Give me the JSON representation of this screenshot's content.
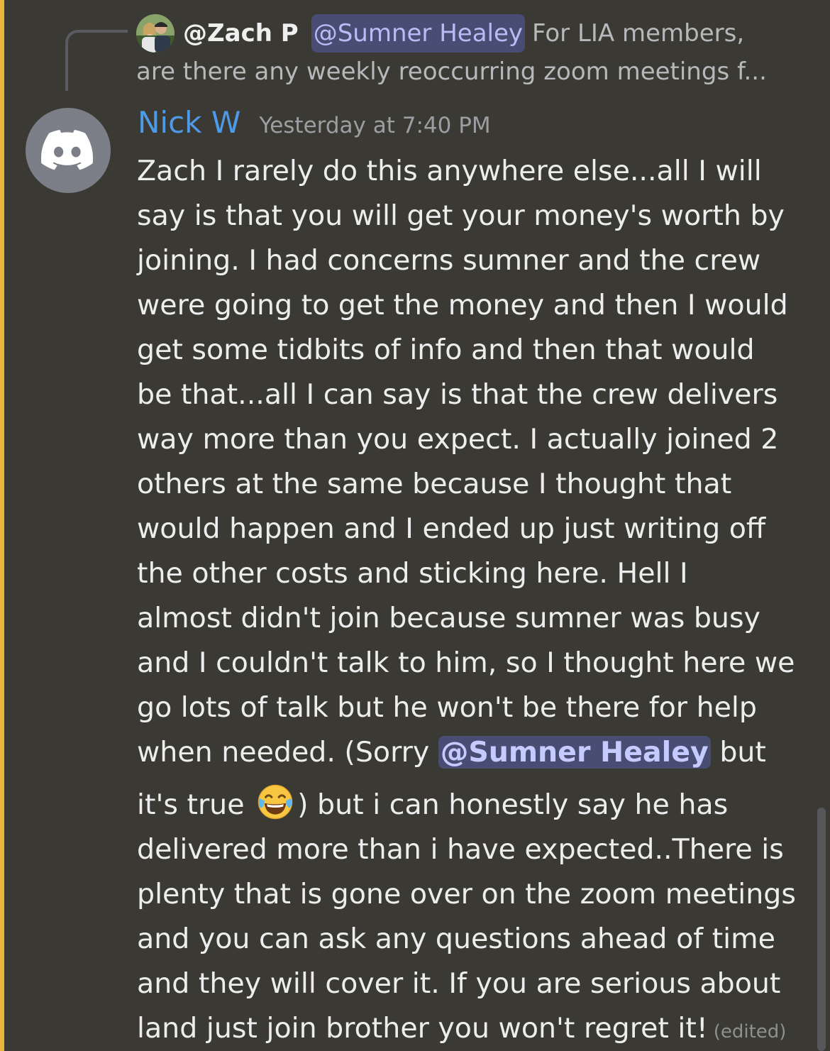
{
  "reply": {
    "author": "@Zach P",
    "mention": "@Sumner Healey",
    "preview_line1": "For LIA members,",
    "preview_line2": "are there any weekly reoccurring zoom meetings f..."
  },
  "message": {
    "author": "Nick W",
    "timestamp": "Yesterday at 7:40 PM",
    "avatar_icon": "discord-logo-icon",
    "lines": [
      "Zach I rarely do this anywhere else...all I will",
      "say is that you will get your money's worth by",
      "joining. I had concerns sumner and the crew",
      "were going to get the money and then I would",
      "get some tidbits of info and then that would",
      "be that...all I can say is that the crew delivers",
      "way more than you expect. I actually joined 2",
      "others at the same because I thought that",
      "would happen and I ended up just writing off",
      "the other costs and sticking here. Hell I",
      "almost didn't join because sumner was busy",
      "and I couldn't talk to him, so I thought here we",
      "go lots of talk but he won't be there for help"
    ],
    "mention_line": {
      "before": "when needed. (Sorry ",
      "mention": "@Sumner Healey",
      "after": " but"
    },
    "emoji_line": {
      "before": "it's true ",
      "emoji_name": "face-with-tears-of-joy-icon",
      "after": ")  but i can honestly say he has"
    },
    "lines_after": [
      "delivered more than i have expected..There is",
      "plenty that is gone over on the zoom meetings",
      "and you can ask any questions ahead of time",
      "and they will cover it. If you are serious about"
    ],
    "last_line": "land just join brother you won't regret it!",
    "edited_label": "(edited)"
  },
  "colors": {
    "background": "#3a3933",
    "highlight_bar": "#e9b63a",
    "author_name": "#4e9ae6",
    "mention_bg": "#4a4d73",
    "mention_text": "#c5cbff"
  }
}
